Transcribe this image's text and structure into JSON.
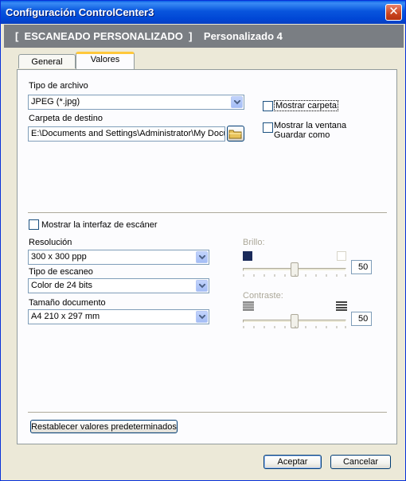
{
  "window": {
    "title": "Configuración ControlCenter3"
  },
  "header": {
    "text": "[  ESCANEADO PERSONALIZADO  ]    Personalizado 4"
  },
  "tabs": [
    {
      "label": "General",
      "active": false
    },
    {
      "label": "Valores",
      "active": true
    }
  ],
  "file": {
    "type_label": "Tipo de archivo",
    "type_value": "JPEG (*.jpg)",
    "dest_label": "Carpeta de destino",
    "dest_value": "E:\\Documents and Settings\\Administrator\\My Docum"
  },
  "options": {
    "show_folder": {
      "label": "Mostrar carpeta",
      "checked": false
    },
    "show_save_as": {
      "label_line1": "Mostrar la ventana",
      "label_line2": "Guardar como",
      "checked": false
    }
  },
  "scanner": {
    "show_interface": {
      "label": "Mostrar la interfaz de escáner",
      "checked": false
    },
    "resolution_label": "Resolución",
    "resolution_value": "300 x 300 ppp",
    "scan_type_label": "Tipo de escaneo",
    "scan_type_value": "Color de 24 bits",
    "doc_size_label": "Tamaño documento",
    "doc_size_value": "A4 210 x 297 mm",
    "brightness_label": "Brillo:",
    "brightness_value": "50",
    "contrast_label": "Contraste:",
    "contrast_value": "50"
  },
  "buttons": {
    "reset": "Restablecer valores predeterminados",
    "ok": "Aceptar",
    "cancel": "Cancelar"
  },
  "colors": {
    "titlebar": "#0855dd",
    "header_band": "#7a7e83",
    "tab_highlight": "#ffc83c"
  }
}
